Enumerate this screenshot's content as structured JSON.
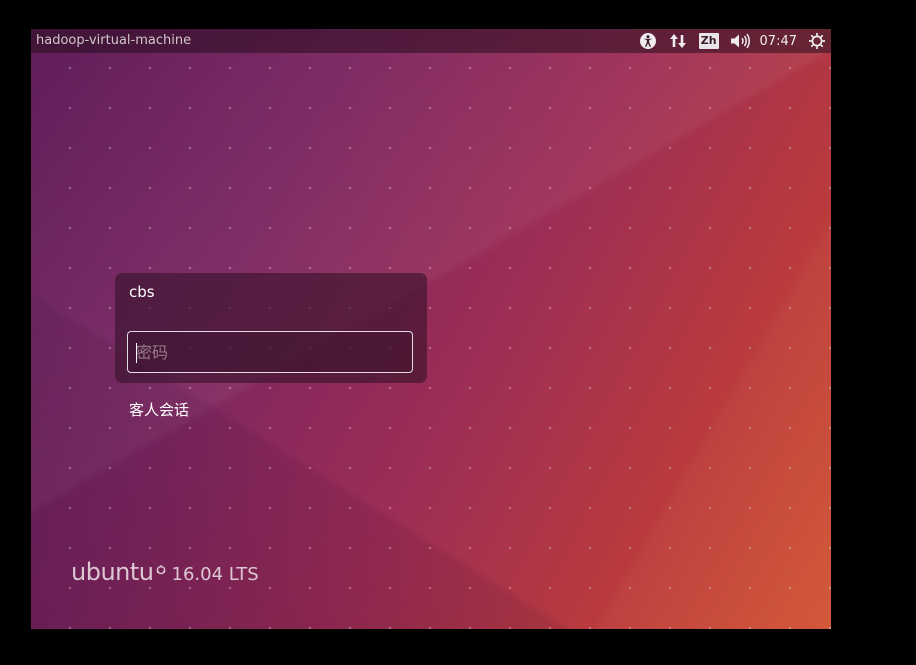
{
  "topbar": {
    "hostname": "hadoop-virtual-machine",
    "keyboard_layout": "Zh",
    "clock": "07:47",
    "icons": [
      "accessibility-icon",
      "network-icon",
      "keyboard-indicator",
      "volume-icon",
      "power-icon"
    ]
  },
  "login": {
    "username": "cbs",
    "password_placeholder": "密码",
    "password_value": "",
    "guest_session_label": "客人会话"
  },
  "branding": {
    "word": "ubuntu",
    "version": "16.04 LTS"
  },
  "colors": {
    "wallpaper_start": "#5e1d5a",
    "wallpaper_end": "#c8472c",
    "panel": "#280c1e",
    "text": "#ffffff"
  }
}
